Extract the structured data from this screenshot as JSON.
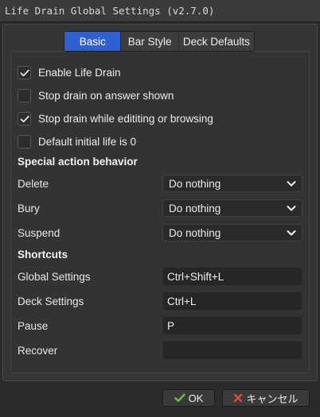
{
  "window": {
    "title": "Life Drain Global Settings (v2.7.0)"
  },
  "tabs": [
    {
      "label": "Basic",
      "active": true
    },
    {
      "label": "Bar Style",
      "active": false
    },
    {
      "label": "Deck Defaults",
      "active": false
    }
  ],
  "options": [
    {
      "label": "Enable Life Drain",
      "checked": true
    },
    {
      "label": "Stop drain on answer shown",
      "checked": false
    },
    {
      "label": "Stop drain while edititing or browsing",
      "checked": true
    },
    {
      "label": "Default initial life is 0",
      "checked": false
    }
  ],
  "special_action": {
    "heading": "Special action behavior",
    "rows": [
      {
        "label": "Delete",
        "value": "Do nothing"
      },
      {
        "label": "Bury",
        "value": "Do nothing"
      },
      {
        "label": "Suspend",
        "value": "Do nothing"
      }
    ]
  },
  "shortcuts": {
    "heading": "Shortcuts",
    "rows": [
      {
        "label": "Global Settings",
        "value": "Ctrl+Shift+L"
      },
      {
        "label": "Deck Settings",
        "value": "Ctrl+L"
      },
      {
        "label": "Pause",
        "value": "P"
      },
      {
        "label": "Recover",
        "value": ""
      }
    ]
  },
  "buttons": {
    "ok_label": "OK",
    "ok_icon": "checkmark-green-icon",
    "cancel_label": "キャンセル",
    "cancel_icon": "x-red-icon"
  },
  "colors": {
    "accent": "#2f5fd0",
    "background": "#2b2b2b",
    "ok_icon": "#6cc04a",
    "cancel_icon": "#e04848"
  }
}
